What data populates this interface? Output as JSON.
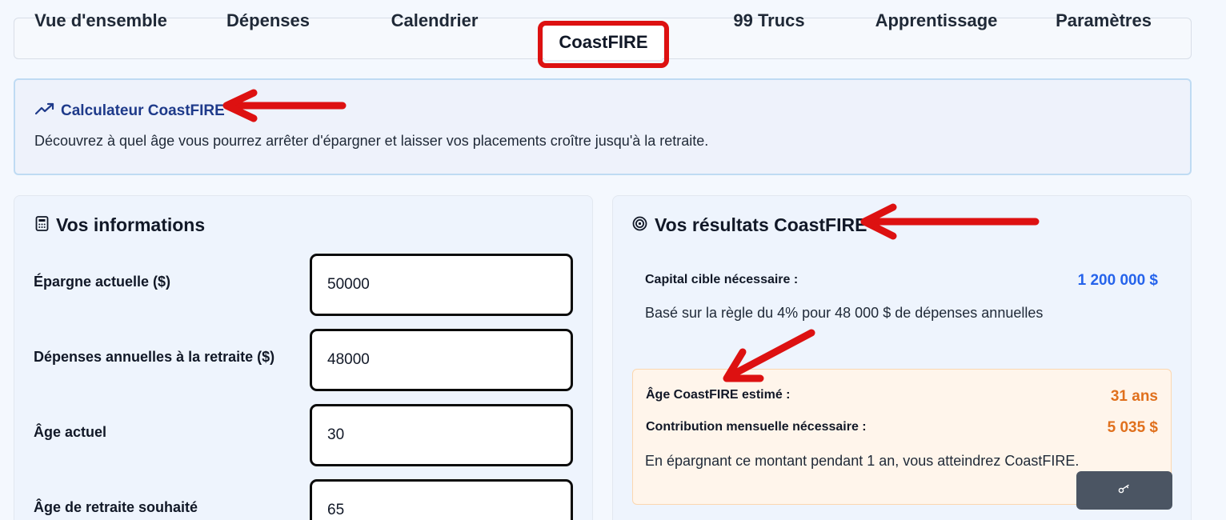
{
  "tabs": {
    "items": [
      {
        "label": "Vue d'ensemble"
      },
      {
        "label": "Dépenses"
      },
      {
        "label": "Calendrier"
      },
      {
        "label": "CoastFIRE",
        "active": true
      },
      {
        "label": "99 Trucs"
      },
      {
        "label": "Apprentissage"
      },
      {
        "label": "Paramètres"
      }
    ]
  },
  "intro": {
    "icon": "trending-up-icon",
    "title": "Calculateur CoastFIRE",
    "description": "Découvrez à quel âge vous pourrez arrêter d'épargner et laisser vos placements croître jusqu'à la retraite."
  },
  "form": {
    "icon": "calculator-icon",
    "title": "Vos informations",
    "fields": [
      {
        "label": "Épargne actuelle ($)",
        "value": "50000"
      },
      {
        "label": "Dépenses annuelles à la retraite ($)",
        "value": "48000"
      },
      {
        "label": "Âge actuel",
        "value": "30"
      },
      {
        "label": "Âge de retraite souhaité",
        "value": "65"
      }
    ]
  },
  "results": {
    "icon": "target-icon",
    "title": "Vos résultats CoastFIRE",
    "target_label": "Capital cible nécessaire :",
    "target_value": "1 200 000 $",
    "target_note": "Basé sur la règle du 4% pour 48 000 $ de dépenses annuelles",
    "age_label": "Âge CoastFIRE estimé :",
    "age_value": "31 ans",
    "contribution_label": "Contribution mensuelle nécessaire :",
    "contribution_value": "5 035 $",
    "contribution_note": "En épargnant ce montant pendant 1 an, vous atteindrez CoastFIRE."
  },
  "floating_button": {
    "icon": "key-icon"
  },
  "colors": {
    "accent_blue": "#2563eb",
    "title_blue": "#1e3a8a",
    "orange": "#e0701d",
    "annotation_red": "#dd1111"
  }
}
